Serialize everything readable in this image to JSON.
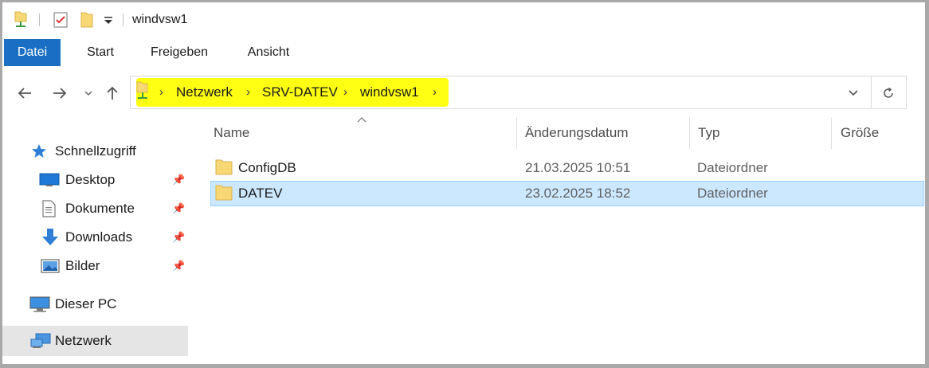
{
  "window": {
    "title": "windvsw1",
    "quick_access_icons": [
      "network-folder-icon",
      "properties-checklist-icon",
      "new-folder-icon",
      "customize-dropdown-icon"
    ]
  },
  "ribbon": {
    "tabs": [
      {
        "label": "Datei",
        "active": true
      },
      {
        "label": "Start"
      },
      {
        "label": "Freigeben"
      },
      {
        "label": "Ansicht"
      }
    ]
  },
  "navigation": {
    "back": "back-arrow-icon",
    "forward": "forward-arrow-icon",
    "recent": "chevron-down-icon",
    "up": "up-arrow-icon"
  },
  "address": {
    "crumbs": [
      "Netzwerk",
      "SRV-DATEV",
      "windvsw1"
    ],
    "highlight_color": "#ffff14"
  },
  "sidebar": {
    "items": [
      {
        "label": "Schnellzugriff",
        "icon": "star-icon"
      },
      {
        "label": "Desktop",
        "icon": "desktop-icon",
        "pinned": true
      },
      {
        "label": "Dokumente",
        "icon": "documents-icon",
        "pinned": true
      },
      {
        "label": "Downloads",
        "icon": "download-arrow-icon",
        "pinned": true
      },
      {
        "label": "Bilder",
        "icon": "pictures-icon",
        "pinned": true
      },
      {
        "label": "Dieser PC",
        "icon": "computer-icon"
      },
      {
        "label": "Netzwerk",
        "icon": "network-icon",
        "selected": true
      }
    ]
  },
  "file_list": {
    "columns": [
      "Name",
      "Änderungsdatum",
      "Typ",
      "Größe"
    ],
    "sort_column": "Name",
    "rows": [
      {
        "name": "ConfigDB",
        "date": "21.03.2025 10:51",
        "type": "Dateiordner",
        "size": ""
      },
      {
        "name": "DATEV",
        "date": "23.02.2025 18:52",
        "type": "Dateiordner",
        "size": "",
        "selected": true
      }
    ]
  },
  "colors": {
    "file_tab": "#1a6fc4",
    "selection": "#cce8ff",
    "folder": "#f8d775"
  }
}
